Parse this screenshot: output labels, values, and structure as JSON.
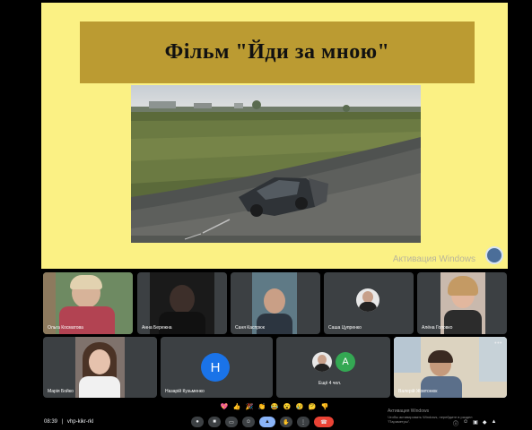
{
  "slide": {
    "title": "Фільм \"Йди за мною\"",
    "activation": "Активация Windows"
  },
  "participants": [
    {
      "name": "Ольга Косматова"
    },
    {
      "name": "Анна Бережна"
    },
    {
      "name": "Саня Каспрюк"
    },
    {
      "name": "Саша Цупренко"
    },
    {
      "name": "Алёна Головко"
    },
    {
      "name": "Марія Бойко"
    },
    {
      "name": "Назарій Кузьменко",
      "initial": "H"
    },
    {
      "name": "Ещё 4 чел.",
      "initial": "A"
    },
    {
      "name": "Валерій Жовтонюк"
    }
  ],
  "bottom": {
    "time": "08:39",
    "separator": "|",
    "code": "vhp-kikr-rkl",
    "reactions": [
      "💖",
      "👍",
      "🎉",
      "👏",
      "😂",
      "😮",
      "😢",
      "🤔",
      "👎"
    ],
    "win_activation_line1": "Активация Windows",
    "win_activation_line2": "Чтобы активировать Windows, перейдите в раздел",
    "win_activation_line3": "\"Параметры\"."
  },
  "colors": {
    "slide_bg": "#fbf184",
    "title_box": "#bb9b32",
    "tile_bg": "#3c4043",
    "avatar_blue": "#1a73e8",
    "avatar_green": "#34a853",
    "end_call": "#ea4335",
    "active_blue": "#8ab4f8"
  }
}
